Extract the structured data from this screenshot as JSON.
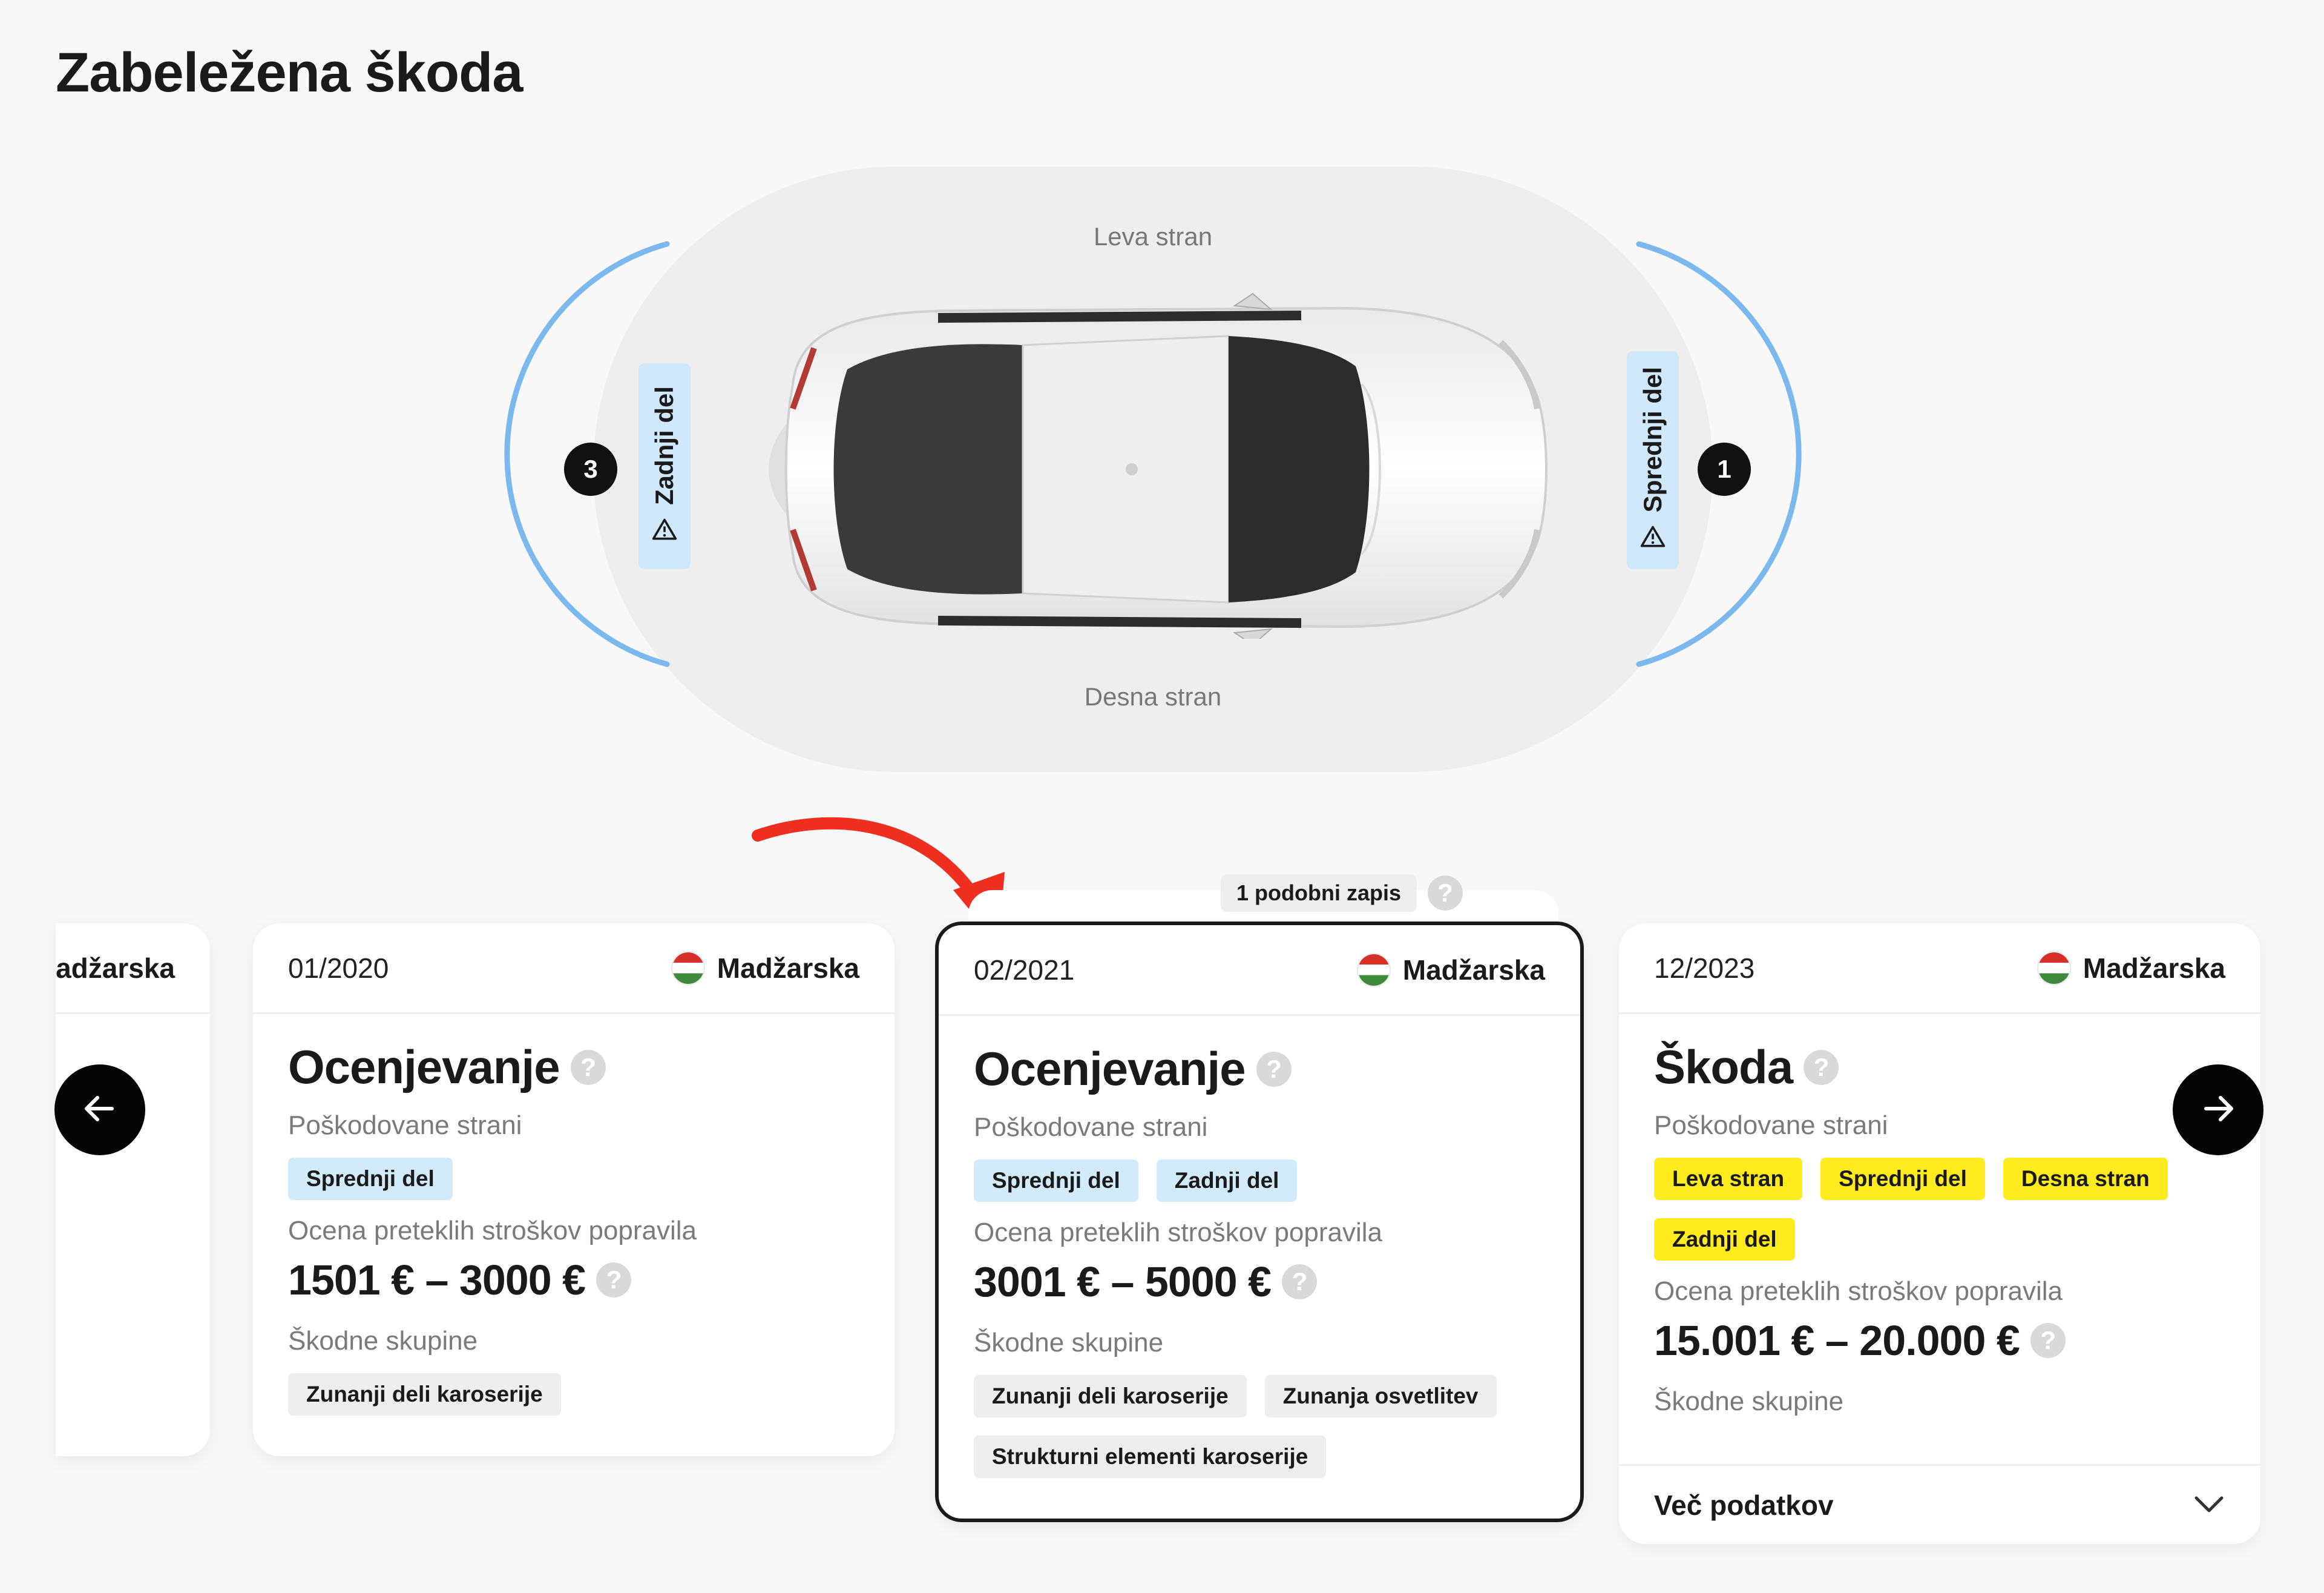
{
  "page": {
    "title": "Zabeležena škoda"
  },
  "diagram": {
    "left_side": "Leva stran",
    "right_side": "Desna stran",
    "rear": {
      "label": "Zadnji del",
      "count": "3"
    },
    "front": {
      "label": "Sprednji del",
      "count": "1"
    }
  },
  "similar_records": {
    "label": "1 podobni zapis",
    "help": "?"
  },
  "cards": [
    {
      "date": "",
      "country": "Madžarska"
    },
    {
      "date": "01/2020",
      "country": "Madžarska",
      "title": "Ocenjevanje",
      "damaged_sides_label": "Poškodovane strani",
      "damaged_sides": [
        "Sprednji del"
      ],
      "repair_cost_label": "Ocena preteklih stroškov popravila",
      "repair_cost": "1501 € – 3000 €",
      "damage_groups_label": "Škodne skupine",
      "damage_groups": [
        "Zunanji deli karoserije"
      ]
    },
    {
      "date": "02/2021",
      "country": "Madžarska",
      "title": "Ocenjevanje",
      "damaged_sides_label": "Poškodovane strani",
      "damaged_sides": [
        "Sprednji del",
        "Zadnji del"
      ],
      "repair_cost_label": "Ocena preteklih stroškov popravila",
      "repair_cost": "3001 € – 5000 €",
      "damage_groups_label": "Škodne skupine",
      "damage_groups": [
        "Zunanji deli karoserije",
        "Zunanja osvetlitev",
        "Strukturni elementi karoserije"
      ]
    },
    {
      "date": "12/2023",
      "country": "Madžarska",
      "title": "Škoda",
      "damaged_sides_label": "Poškodovane strani",
      "damaged_sides": [
        "Leva stran",
        "Sprednji del",
        "Desna stran",
        "Zadnji del"
      ],
      "repair_cost_label": "Ocena preteklih stroškov popravila",
      "repair_cost": "15.001 € – 20.000 €",
      "damage_groups_label": "Škodne skupine",
      "more_label": "Več podatkov"
    }
  ],
  "colors": {
    "accent_blue": "#7bb8ee",
    "chip_blue": "#d2ebfb",
    "chip_yellow": "#ffeb1e",
    "annotation_arrow": "#ee2e1f"
  },
  "icons": {
    "prev": "arrow-left-icon",
    "next": "arrow-right-icon",
    "warning": "warning-triangle-icon",
    "help": "question-circle-icon",
    "expand": "chevron-down-icon"
  }
}
